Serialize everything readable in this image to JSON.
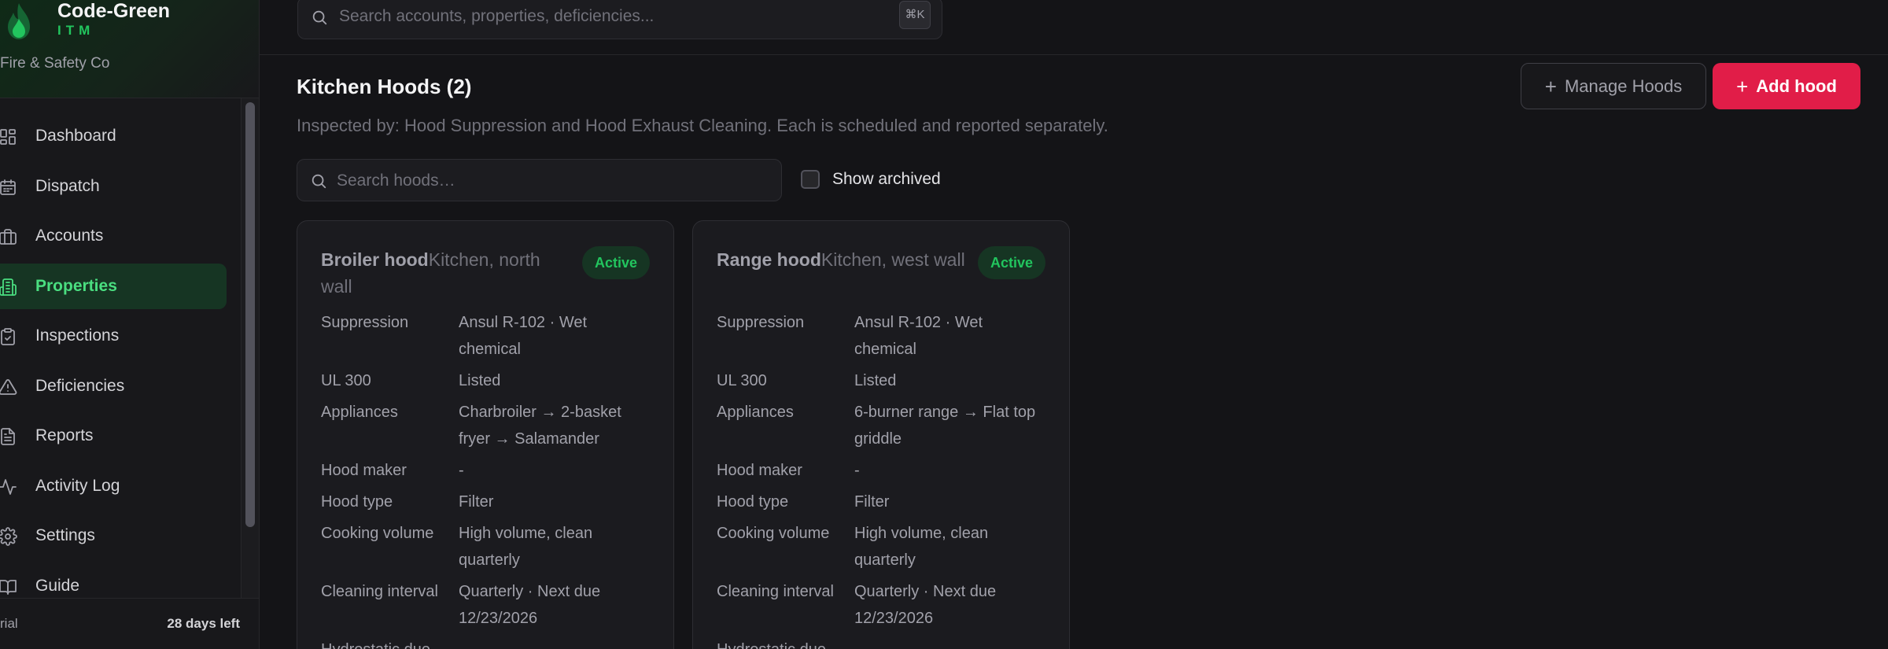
{
  "brand": {
    "name": "Code-Green",
    "sub": "ITM",
    "org": "Fire & Safety Co"
  },
  "search": {
    "placeholder": "Search accounts, properties, deficiencies...",
    "shortcut": "⌘K"
  },
  "nav": [
    {
      "label": "Dashboard",
      "icon": "dashboard-icon",
      "active": false
    },
    {
      "label": "Dispatch",
      "icon": "calendar-icon",
      "active": false
    },
    {
      "label": "Accounts",
      "icon": "briefcase-icon",
      "active": false
    },
    {
      "label": "Properties",
      "icon": "building-icon",
      "active": true
    },
    {
      "label": "Inspections",
      "icon": "clipboard-check-icon",
      "active": false
    },
    {
      "label": "Deficiencies",
      "icon": "warning-icon",
      "active": false
    },
    {
      "label": "Reports",
      "icon": "document-icon",
      "active": false
    },
    {
      "label": "Activity Log",
      "icon": "activity-icon",
      "active": false
    },
    {
      "label": "Settings",
      "icon": "gear-icon",
      "active": false
    },
    {
      "label": "Guide",
      "icon": "book-icon",
      "active": false
    }
  ],
  "trial": {
    "label": "rial",
    "days_left": "28 days left"
  },
  "page": {
    "title": "Kitchen Hoods (2)",
    "description": "Inspected by: Hood Suppression and Hood Exhaust Cleaning. Each is scheduled and reported separately.",
    "manage_label": "Manage Hoods",
    "add_label": "Add hood",
    "hood_search_placeholder": "Search hoods…",
    "show_archived_label": "Show archived"
  },
  "cards": [
    {
      "name": "Broiler hood",
      "location": "Kitchen, north wall",
      "status": "Active",
      "specs": [
        {
          "key": "Suppression",
          "value": "Ansul R-102 · Wet chemical"
        },
        {
          "key": "UL 300",
          "value": "Listed"
        },
        {
          "key": "Appliances",
          "value": "Charbroiler → 2-basket fryer → Salamander"
        },
        {
          "key": "Hood maker",
          "value": "-"
        },
        {
          "key": "Hood type",
          "value": "Filter"
        },
        {
          "key": "Cooking volume",
          "value": "High volume, clean quarterly"
        },
        {
          "key": "Cleaning interval",
          "value": "Quarterly · Next due 12/23/2026"
        },
        {
          "key": "Hydrostatic due",
          "value": ""
        }
      ]
    },
    {
      "name": "Range hood",
      "location": "Kitchen, west wall",
      "status": "Active",
      "specs": [
        {
          "key": "Suppression",
          "value": "Ansul R-102 · Wet chemical"
        },
        {
          "key": "UL 300",
          "value": "Listed"
        },
        {
          "key": "Appliances",
          "value": "6-burner range → Flat top griddle"
        },
        {
          "key": "Hood maker",
          "value": "-"
        },
        {
          "key": "Hood type",
          "value": "Filter"
        },
        {
          "key": "Cooking volume",
          "value": "High volume, clean quarterly"
        },
        {
          "key": "Cleaning interval",
          "value": "Quarterly · Next due 12/23/2026"
        },
        {
          "key": "Hydrostatic due",
          "value": ""
        }
      ]
    }
  ],
  "colors": {
    "brand_green": "#22c55e",
    "active_nav_bg": "#163523",
    "primary_button": "#e11d48",
    "background": "#141417"
  }
}
